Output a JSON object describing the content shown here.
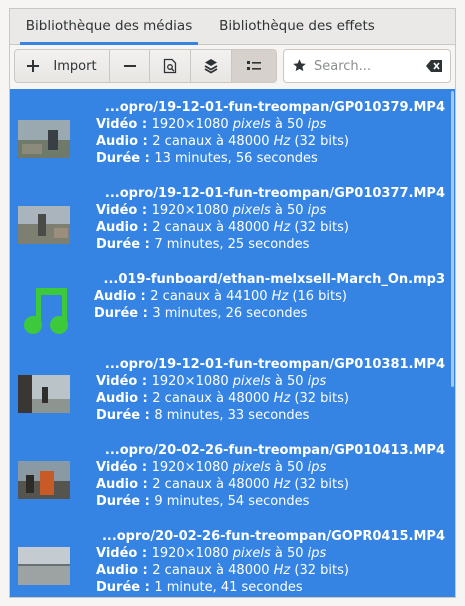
{
  "tabs": [
    {
      "label": "Bibliothèque des médias",
      "active": true
    },
    {
      "label": "Bibliothèque des effets",
      "active": false
    }
  ],
  "toolbar": {
    "import_label": "Import",
    "import_icon": "plus-icon",
    "remove_icon": "minus-icon",
    "clip_properties_icon": "clip-properties-icon",
    "proxy_icon": "proxy-icon",
    "view_mode_icon": "list-view-icon"
  },
  "search": {
    "placeholder": "Search...",
    "value": ""
  },
  "colors": {
    "selection": "#3584e4",
    "accent": "#3584e4",
    "music_icon": "#3cc93c"
  },
  "labels": {
    "video": "Vidéo : ",
    "audio": "Audio : ",
    "duration": "Durée : ",
    "pixels": "pixels",
    "fps_sep": " à 50 ",
    "ips": "ips",
    "resolution": "1920×1080 ",
    "hz": "Hz"
  },
  "items": [
    {
      "name": "...opro/19-12-01-fun-treompan/GP010379.MP4",
      "video": true,
      "audio_pre": "2 canaux à 48000 ",
      "audio_bits": "(32 bits)",
      "duration": "13 minutes, 56 secondes"
    },
    {
      "name": "...opro/19-12-01-fun-treompan/GP010377.MP4",
      "video": true,
      "audio_pre": "2 canaux à 48000 ",
      "audio_bits": "(32 bits)",
      "duration": "7 minutes, 25 secondes"
    },
    {
      "name": "...019-funboard/ethan-melxsell-March_On.mp3",
      "video": false,
      "audio_pre": "2 canaux à 44100 ",
      "audio_bits": "(16 bits)",
      "duration": "3 minutes, 26 secondes"
    },
    {
      "name": "...opro/19-12-01-fun-treompan/GP010381.MP4",
      "video": true,
      "audio_pre": "2 canaux à 48000 ",
      "audio_bits": "(32 bits)",
      "duration": "8 minutes, 33 secondes"
    },
    {
      "name": "...opro/20-02-26-fun-treompan/GP010413.MP4",
      "video": true,
      "audio_pre": "2 canaux à 48000 ",
      "audio_bits": "(32 bits)",
      "duration": "9 minutes, 54 secondes"
    },
    {
      "name": "...opro/20-02-26-fun-treompan/GOPR0415.MP4",
      "video": true,
      "audio_pre": "2 canaux à 48000 ",
      "audio_bits": "(32 bits)",
      "duration": "1 minute, 41 secondes"
    }
  ]
}
